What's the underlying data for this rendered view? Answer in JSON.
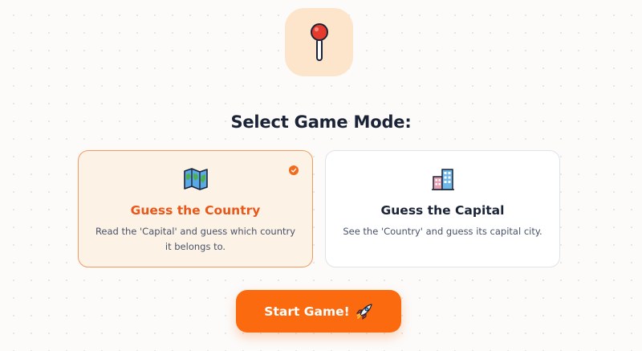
{
  "logo": {
    "icon": "pushpin-icon",
    "tile_color": "#fde5cb"
  },
  "heading": "Select Game Mode:",
  "modes": [
    {
      "title": "Guess the Country",
      "description": "Read the 'Capital' and guess which country it belongs to.",
      "icon": "world-map-icon",
      "selected": true
    },
    {
      "title": "Guess the Capital",
      "description": "See the 'Country' and guess its capital city.",
      "icon": "city-buildings-icon",
      "selected": false
    }
  ],
  "start_button": {
    "label": "Start Game!",
    "icon": "rocket-icon",
    "color": "#fb6a0e"
  },
  "colors": {
    "accent": "#e8581a",
    "selected_bg": "#fdf2e6",
    "selected_border": "#f29a62",
    "text": "#1b2436"
  }
}
